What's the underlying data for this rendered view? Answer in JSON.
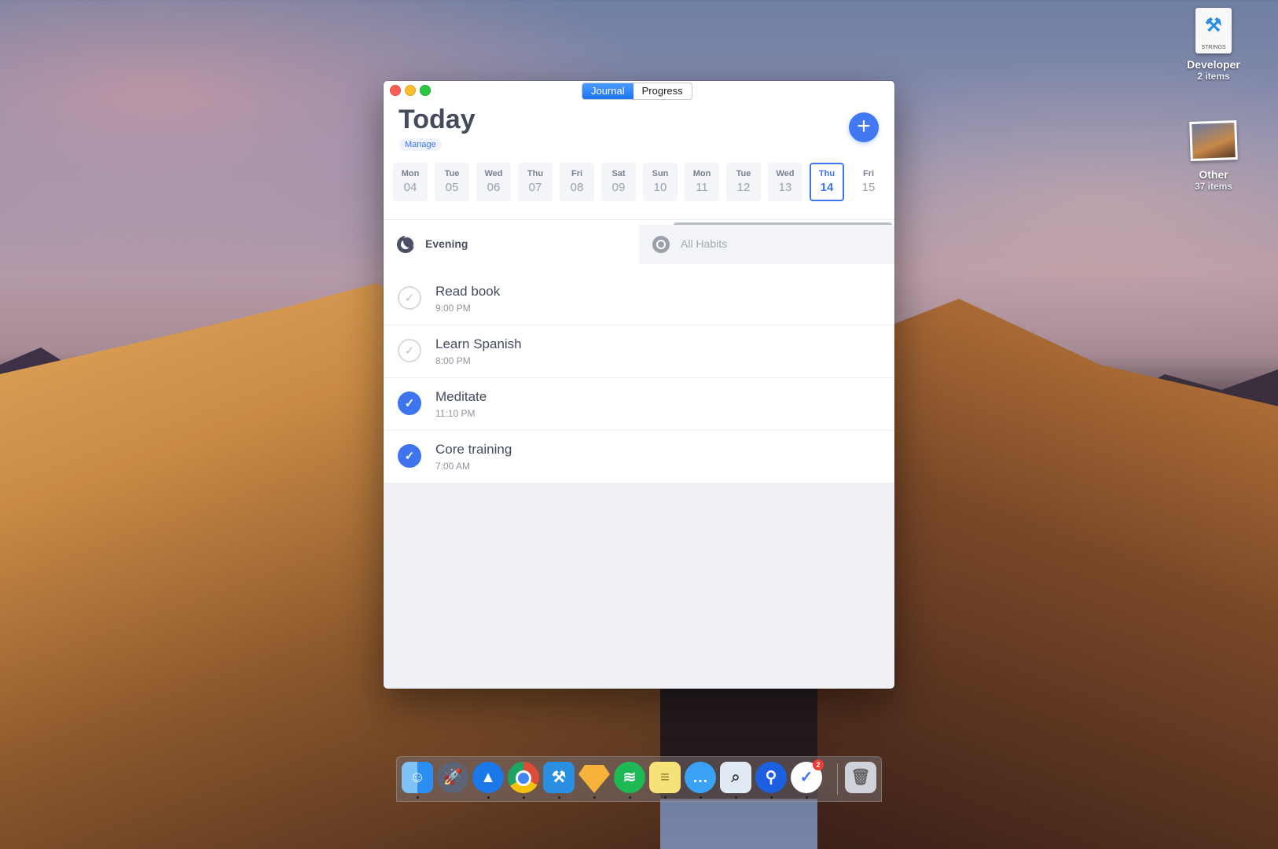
{
  "desktop": {
    "items": [
      {
        "name": "Developer",
        "sub": "2 items",
        "icon_label": "STRINGS"
      },
      {
        "name": "Other",
        "sub": "37 items"
      }
    ]
  },
  "window": {
    "tabs": [
      {
        "label": "Journal",
        "active": true
      },
      {
        "label": "Progress",
        "active": false
      }
    ],
    "title": "Today",
    "manage_label": "Manage",
    "add_label": "+",
    "days": [
      {
        "name": "Mon",
        "num": "04"
      },
      {
        "name": "Tue",
        "num": "05"
      },
      {
        "name": "Wed",
        "num": "06"
      },
      {
        "name": "Thu",
        "num": "07"
      },
      {
        "name": "Fri",
        "num": "08"
      },
      {
        "name": "Sat",
        "num": "09"
      },
      {
        "name": "Sun",
        "num": "10"
      },
      {
        "name": "Mon",
        "num": "11"
      },
      {
        "name": "Tue",
        "num": "12"
      },
      {
        "name": "Wed",
        "num": "13"
      },
      {
        "name": "Thu",
        "num": "14",
        "selected": true
      },
      {
        "name": "Fri",
        "num": "15"
      }
    ],
    "filters": {
      "active": {
        "label": "Evening",
        "icon": "moon-icon"
      },
      "inactive": {
        "label": "All Habits",
        "icon": "cycle-icon"
      }
    },
    "habits": [
      {
        "title": "Read book",
        "time": "9:00 PM",
        "done": false
      },
      {
        "title": "Learn Spanish",
        "time": "8:00 PM",
        "done": false
      },
      {
        "title": "Meditate",
        "time": "11:10 PM",
        "done": true
      },
      {
        "title": "Core training",
        "time": "7:00 AM",
        "done": true
      }
    ]
  },
  "dock": {
    "items": [
      {
        "name": "finder",
        "color": "#2b8ef2"
      },
      {
        "name": "launchpad",
        "color": "#5c6475"
      },
      {
        "name": "spark-mail",
        "color": "#1a78e8"
      },
      {
        "name": "chrome",
        "color": "#dd4b39"
      },
      {
        "name": "xcode",
        "color": "#2a8fe0"
      },
      {
        "name": "sketch",
        "color": "#f6b23b"
      },
      {
        "name": "spotify",
        "color": "#1db954"
      },
      {
        "name": "notes",
        "color": "#f7e27a"
      },
      {
        "name": "messages",
        "color": "#3aa2f5"
      },
      {
        "name": "preview",
        "color": "#8fc3ee"
      },
      {
        "name": "1password",
        "color": "#1c5fe0"
      },
      {
        "name": "habit-app",
        "color": "#3f74ef",
        "badge": "2"
      },
      {
        "name": "trash",
        "color": "#cfd2d8"
      }
    ]
  }
}
